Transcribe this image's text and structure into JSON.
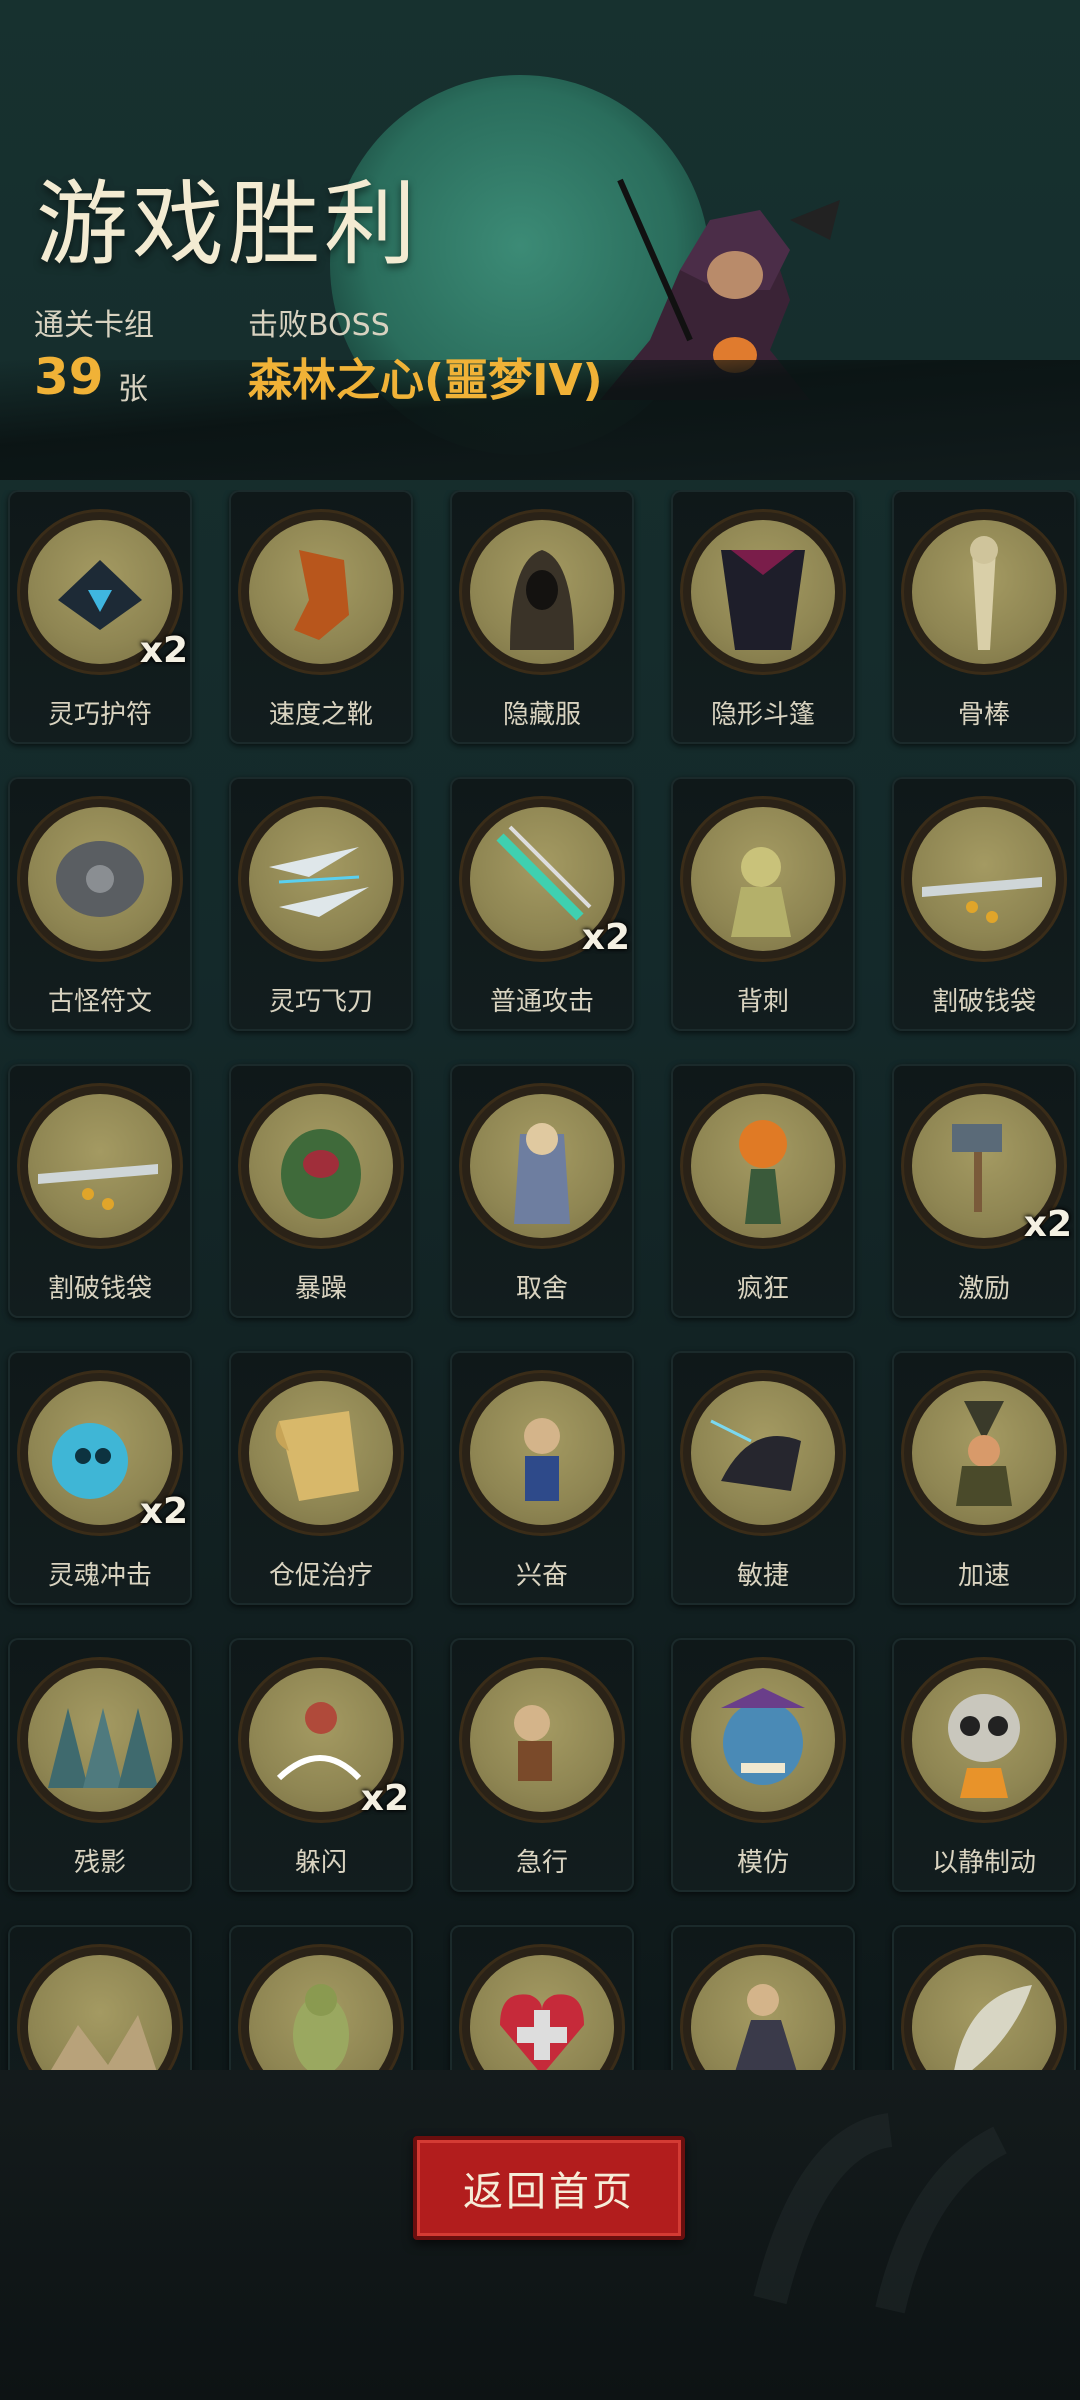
{
  "header": {
    "title": "游戏胜利",
    "deck_label": "通关卡组",
    "deck_count": "39",
    "deck_unit": "张",
    "boss_label": "击败BOSS",
    "boss_name": "森林之心(噩梦IV)"
  },
  "colors": {
    "accent_gold": "#f0b237",
    "button_red": "#b21d1d",
    "card_art": "#8f8653"
  },
  "cards": [
    {
      "label": "灵巧护符",
      "badge": "x2",
      "icon": "charm-icon"
    },
    {
      "label": "速度之靴",
      "badge": "",
      "icon": "boots-icon"
    },
    {
      "label": "隐藏服",
      "badge": "",
      "icon": "hood-icon"
    },
    {
      "label": "隐形斗篷",
      "badge": "",
      "icon": "cloak-icon"
    },
    {
      "label": "骨棒",
      "badge": "",
      "icon": "bone-club-icon"
    },
    {
      "label": "古怪符文",
      "badge": "",
      "icon": "rune-stone-icon"
    },
    {
      "label": "灵巧飞刀",
      "badge": "",
      "icon": "throwing-knife-icon"
    },
    {
      "label": "普通攻击",
      "badge": "x2",
      "icon": "attack-slash-icon"
    },
    {
      "label": "背刺",
      "badge": "",
      "icon": "backstab-icon"
    },
    {
      "label": "割破钱袋",
      "badge": "",
      "icon": "cut-purse-icon"
    },
    {
      "label": "割破钱袋",
      "badge": "",
      "icon": "cut-purse-icon"
    },
    {
      "label": "暴躁",
      "badge": "",
      "icon": "rage-icon"
    },
    {
      "label": "取舍",
      "badge": "",
      "icon": "wizard-icon"
    },
    {
      "label": "疯狂",
      "badge": "",
      "icon": "pumpkin-icon"
    },
    {
      "label": "激励",
      "badge": "x2",
      "icon": "hammer-icon"
    },
    {
      "label": "灵魂冲击",
      "badge": "x2",
      "icon": "soul-strike-icon"
    },
    {
      "label": "仓促治疗",
      "badge": "",
      "icon": "scroll-icon"
    },
    {
      "label": "兴奋",
      "badge": "",
      "icon": "excited-icon"
    },
    {
      "label": "敏捷",
      "badge": "",
      "icon": "panther-icon"
    },
    {
      "label": "加速",
      "badge": "",
      "icon": "witch-icon"
    },
    {
      "label": "残影",
      "badge": "",
      "icon": "afterimage-icon"
    },
    {
      "label": "躲闪",
      "badge": "x2",
      "icon": "dodge-icon"
    },
    {
      "label": "急行",
      "badge": "",
      "icon": "rush-icon"
    },
    {
      "label": "模仿",
      "badge": "",
      "icon": "goblin-icon"
    },
    {
      "label": "以静制动",
      "badge": "",
      "icon": "skull-icon"
    },
    {
      "label": "",
      "badge": "",
      "icon": "map-icon"
    },
    {
      "label": "",
      "badge": "",
      "icon": "creature-icon"
    },
    {
      "label": "",
      "badge": "",
      "icon": "heart-icon"
    },
    {
      "label": "",
      "badge": "",
      "icon": "fighter-icon"
    },
    {
      "label": "",
      "badge": "",
      "icon": "feather-icon"
    }
  ],
  "footer": {
    "home_button": "返回首页"
  }
}
